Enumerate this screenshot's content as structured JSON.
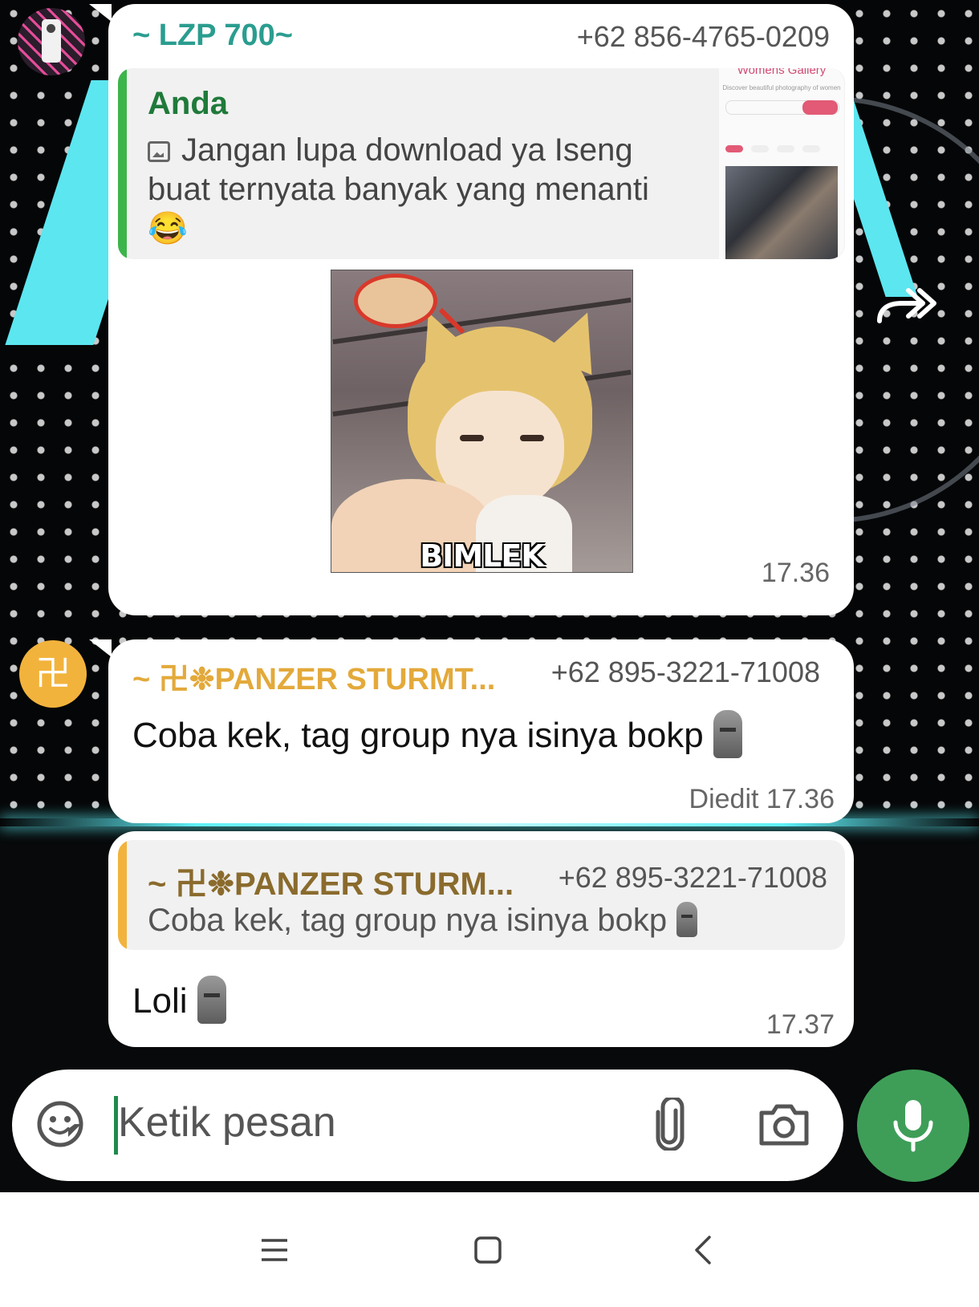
{
  "messages": [
    {
      "sender": "~ LZP 700~",
      "phone": "+62 856-4765-0209",
      "quote": {
        "sender": "Anda",
        "text": "Jangan lupa download ya Iseng buat ternyata banyak yang menanti",
        "emoji": "😂",
        "thumbnail": {
          "title": "Womens Gallery",
          "subtitle": "Discover beautiful photography of women"
        }
      },
      "image_caption": "BIMLEK",
      "time": "17.36"
    },
    {
      "sender": "~ 卍❉PANZER STURMT...",
      "phone": "+62 895-3221-71008",
      "text": "Coba kek, tag group nya isinya bokp",
      "edited_label": "Diedit",
      "time": "17.36"
    },
    {
      "quote": {
        "sender": "~ 卍❉PANZER STURM...",
        "phone": "+62 895-3221-71008",
        "text": "Coba kek, tag group nya isinya bokp"
      },
      "text": "Loli",
      "time": "17.37"
    }
  ],
  "avatar_symbol": "卍",
  "input": {
    "placeholder": "Ketik pesan"
  },
  "icons": {
    "emoji": "sticker-icon",
    "attach": "paperclip-icon",
    "camera": "camera-icon",
    "mic": "microphone-icon",
    "forward": "forward-icon",
    "nav_menu": "menu-icon",
    "nav_home": "home-icon",
    "nav_back": "back-icon"
  },
  "colors": {
    "accent_green": "#3e9e58",
    "sender1": "#2a9d8f",
    "sender2": "#e3a93a",
    "quote_you": "#1f7a3a",
    "quote_other": "#8a6b2d"
  }
}
